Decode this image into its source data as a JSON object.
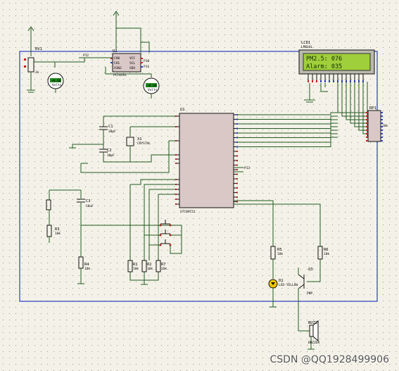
{
  "components": {
    "rv1": {
      "ref": "RV1",
      "value": "1k"
    },
    "u2": {
      "ref": "U2",
      "part": "PCF8591",
      "pins": [
        "VCC",
        "CH0",
        "CH1",
        "SCL",
        "SDA",
        "AIN2"
      ]
    },
    "lcd": {
      "ref": "LCD1",
      "part": "LM016L",
      "line1": "PM2.5:   076",
      "line2": "Alarm:   035"
    },
    "u1": {
      "ref": "U1",
      "part": "STC89C51"
    },
    "c1": {
      "ref": "C1",
      "value": "30pF"
    },
    "c2": {
      "ref": "C2",
      "value": "30pF"
    },
    "x1": {
      "ref": "X1",
      "value": "CRYSTAL"
    },
    "c3": {
      "ref": "C3",
      "value": "10uF"
    },
    "r3": {
      "ref": "R3",
      "value": "10k"
    },
    "r4": {
      "ref": "R4",
      "value": "10k"
    },
    "r1": {
      "ref": "R1",
      "value": "10k"
    },
    "r2": {
      "ref": "R2",
      "value": "10k"
    },
    "r7": {
      "ref": "R7",
      "value": "10k"
    },
    "r5": {
      "ref": "R5",
      "value": "10k"
    },
    "r6": {
      "ref": "R6",
      "value": "10k"
    },
    "rp": {
      "ref": "RP1",
      "value": "10k"
    },
    "d1": {
      "ref": "D1",
      "part": "LED-YELLOW"
    },
    "q3": {
      "ref": "Q3",
      "part": "PNP"
    },
    "buzz": {
      "ref": "BUZ2",
      "part": "BUZZER"
    },
    "vm1": {
      "label": "Volts",
      "value": "+0.00"
    },
    "vm2": {
      "label": "Volts",
      "value": "+0.00"
    }
  },
  "labels": {
    "text_placeholder": "<TEXT>",
    "p10": "P10",
    "p11": "P11",
    "p12": "P12",
    "p13": "P13"
  },
  "watermark": "CSDN @QQ1928499906",
  "colors": {
    "wire": "#1f5a1f",
    "frame": "#2a3fbf",
    "pin_red": "#c81e1e",
    "pin_blue": "#2a3fbf",
    "lcd_screen": "#9fcf3a",
    "chip_fill": "#d9c8c6"
  }
}
